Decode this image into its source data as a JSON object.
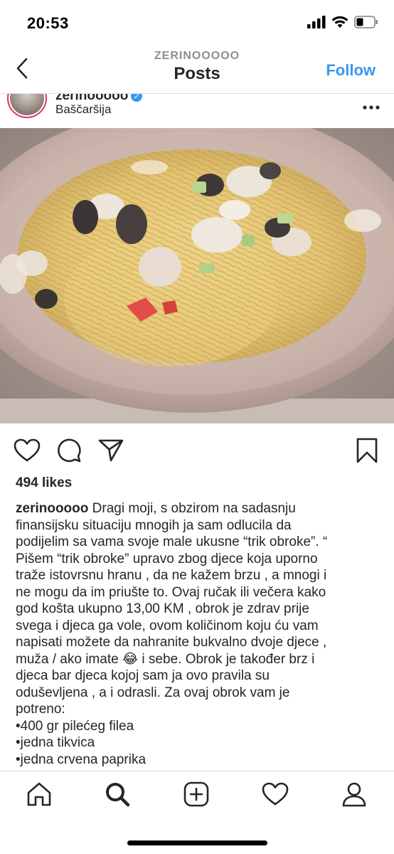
{
  "status_bar": {
    "time": "20:53",
    "icons": [
      "signal-icon",
      "wifi-icon",
      "battery-icon"
    ]
  },
  "header": {
    "username": "ZERINOOOOO",
    "title": "Posts",
    "follow_label": "Follow",
    "back_icon": "chevron-left-icon"
  },
  "post": {
    "username": "zerinooooo",
    "location": "Baščaršija",
    "more_icon": "more-icon",
    "image_alt": "plate of spaghetti with chicken, mushrooms and zucchini",
    "likes": "494 likes",
    "caption_user": "zerinooooo",
    "caption_first": " Dragi moji, s obzirom na sadasnju",
    "caption_lines": [
      "finansijsku  situaciju mnogih ja sam odlucila da",
      "podijelim sa vama  svoje male ukusne “trik obroke”. “",
      "Pišem “trik obroke” upravo zbog djece koja uporno",
      "traže istovrsnu hranu , da ne kažem brzu , a mnogi i",
      "ne mogu da im priušte to. Ovaj ručak ili večera kako",
      "god košta ukupno 13,00 KM , obrok je zdrav prije",
      "svega i djeca ga vole, ovom količinom koju ću vam",
      "napisati možete da nahranite bukvalno dvoje djece ,",
      "muža / ako imate 😂  i sebe. Obrok je također brz i",
      "djeca bar djeca kojoj sam ja ovo pravila su",
      "oduševljena , a i odrasli. Za ovaj obrok vam je",
      "potreno:",
      " •400 gr pilećeg filea",
      "•jedna tikvica",
      "•jedna crvena paprika"
    ]
  },
  "actions": [
    "heart-icon",
    "comment-icon",
    "share-icon",
    "bookmark-icon"
  ],
  "bottom_nav": [
    "home-icon",
    "search-icon",
    "new-post-icon",
    "activity-icon",
    "profile-icon"
  ],
  "colors": {
    "accent": "#3897f0",
    "text": "#262626",
    "muted": "#8e8e8e",
    "divider": "#dbdbdb"
  }
}
